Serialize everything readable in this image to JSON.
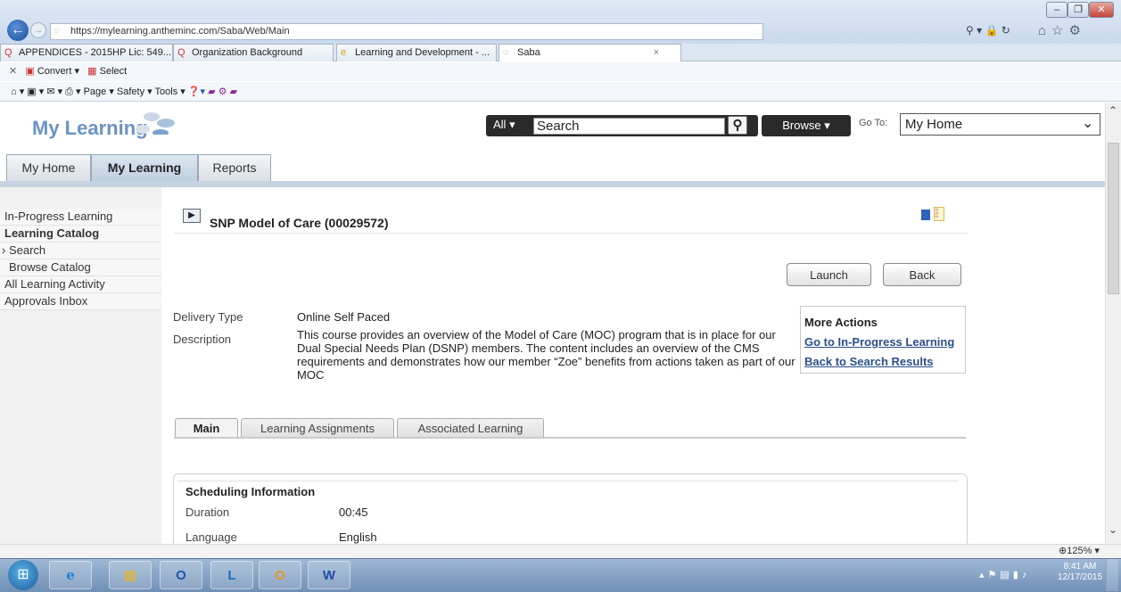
{
  "browser": {
    "url": "https://mylearning.antheminc.com/Saba/Web/Main",
    "tabs": [
      {
        "label": "APPENDICES - 2015HP Lic: 549..."
      },
      {
        "label": "Organization Background"
      },
      {
        "label": "Learning and Development - ..."
      },
      {
        "label": "Saba"
      }
    ],
    "close_tab": "×",
    "convert_label": "Convert",
    "select_label": "Select",
    "command_bar": "Page ▾   Safety ▾   Tools ▾",
    "zoom": "125%"
  },
  "header": {
    "logo_text": "My Learning",
    "search_scope": "All",
    "search_value": "Search",
    "browse_label": "Browse",
    "goto_label": "Go To:",
    "goto_value": "My Home"
  },
  "nav_tabs": [
    {
      "label": "My Home"
    },
    {
      "label": "My Learning"
    },
    {
      "label": "Reports"
    }
  ],
  "sidebar": {
    "items": [
      {
        "label": "In-Progress Learning"
      },
      {
        "label": "Learning Catalog"
      },
      {
        "label": "› Search"
      },
      {
        "label": "Browse Catalog"
      },
      {
        "label": "All Learning Activity"
      },
      {
        "label": "Approvals Inbox"
      }
    ]
  },
  "course": {
    "title": "SNP Model of Care (00029572)",
    "launch_label": "Launch",
    "back_label": "Back",
    "delivery_type_label": "Delivery Type",
    "delivery_type_value": "Online Self Paced",
    "description_label": "Description",
    "description_value": "This course provides an overview of the Model of Care (MOC) program that is in place for our Dual Special Needs Plan (DSNP) members. The content includes an overview of the CMS requirements and demonstrates how our member “Zoe” benefits from actions taken as part of our MOC"
  },
  "more_actions": {
    "title": "More Actions",
    "links": [
      {
        "label": "Go to In-Progress Learning"
      },
      {
        "label": "Back to Search Results"
      }
    ]
  },
  "content_tabs": [
    {
      "label": "Main"
    },
    {
      "label": "Learning Assignments"
    },
    {
      "label": "Associated Learning"
    }
  ],
  "scheduling": {
    "title": "Scheduling Information",
    "rows": [
      {
        "label": "Duration",
        "value": "00:45"
      },
      {
        "label": "Language",
        "value": "English"
      }
    ]
  },
  "taskbar": {
    "time": "8:41 AM",
    "date": "12/17/2015"
  }
}
